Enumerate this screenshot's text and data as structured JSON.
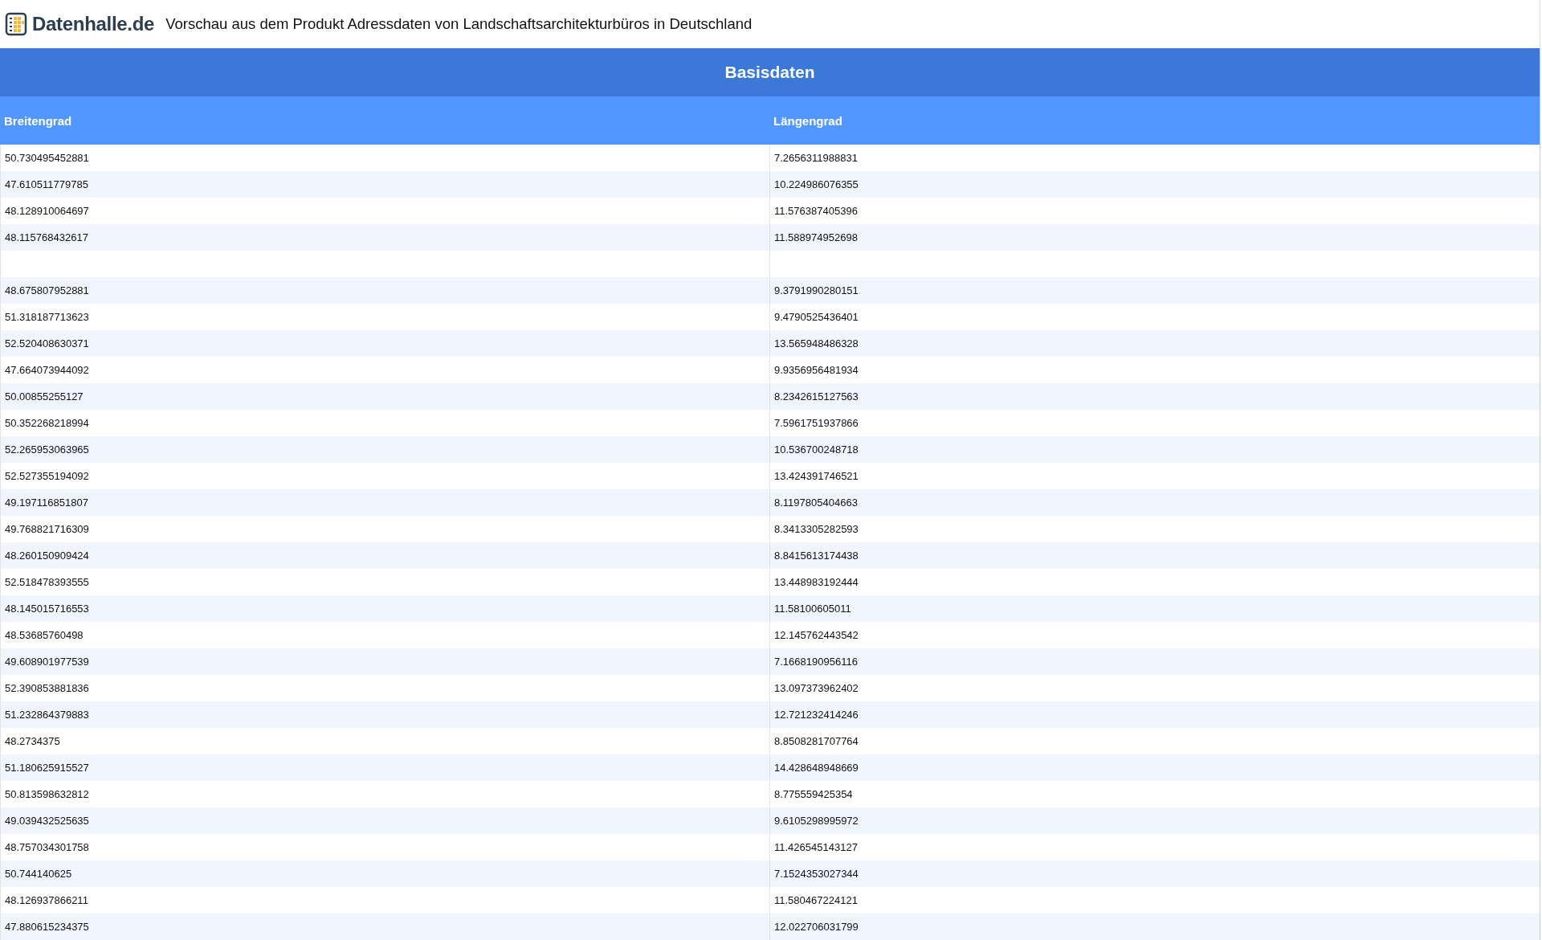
{
  "header": {
    "logo_text": "Datenhalle.de",
    "title": "Vorschau aus dem Produkt Adressdaten von Landschaftsarchitekturbüros in Deutschland"
  },
  "table": {
    "section_title": "Basisdaten",
    "columns": [
      "Breitengrad",
      "Längengrad"
    ],
    "rows": [
      {
        "cells": [
          "50.730495452881",
          "7.2656311988831"
        ]
      },
      {
        "cells": [
          "47.610511779785",
          "10.224986076355"
        ]
      },
      {
        "cells": [
          "48.128910064697",
          "11.576387405396"
        ]
      },
      {
        "cells": [
          "48.115768432617",
          "11.588974952698"
        ]
      },
      {},
      {
        "cells": [
          "48.675807952881",
          "9.3791990280151"
        ]
      },
      {
        "cells": [
          "51.318187713623",
          "9.4790525436401"
        ]
      },
      {
        "cells": [
          "52.520408630371",
          "13.565948486328"
        ]
      },
      {
        "cells": [
          "47.664073944092",
          "9.9356956481934"
        ]
      },
      {
        "cells": [
          "50.00855255127",
          "8.2342615127563"
        ]
      },
      {
        "cells": [
          "50.352268218994",
          "7.5961751937866"
        ]
      },
      {
        "cells": [
          "52.265953063965",
          "10.536700248718"
        ]
      },
      {
        "cells": [
          "52.527355194092",
          "13.424391746521"
        ]
      },
      {
        "cells": [
          "49.197116851807",
          "8.1197805404663"
        ]
      },
      {
        "cells": [
          "49.768821716309",
          "8.3413305282593"
        ]
      },
      {
        "cells": [
          "48.260150909424",
          "8.8415613174438"
        ]
      },
      {
        "cells": [
          "52.518478393555",
          "13.448983192444"
        ]
      },
      {
        "cells": [
          "48.145015716553",
          "11.58100605011"
        ]
      },
      {
        "cells": [
          "48.53685760498",
          "12.145762443542"
        ]
      },
      {
        "cells": [
          "49.608901977539",
          "7.1668190956116"
        ]
      },
      {
        "cells": [
          "52.390853881836",
          "13.097373962402"
        ]
      },
      {
        "cells": [
          "51.232864379883",
          "12.721232414246"
        ]
      },
      {
        "cells": [
          "48.2734375",
          "8.8508281707764"
        ]
      },
      {
        "cells": [
          "51.180625915527",
          "14.428648948669"
        ]
      },
      {
        "cells": [
          "50.813598632812",
          "8.775559425354"
        ]
      },
      {
        "cells": [
          "49.039432525635",
          "9.6105298995972"
        ]
      },
      {
        "cells": [
          "48.757034301758",
          "11.426545143127"
        ]
      },
      {
        "cells": [
          "50.744140625",
          "7.1524353027344"
        ]
      },
      {
        "cells": [
          "48.126937866211",
          "11.580467224121"
        ]
      },
      {
        "cells": [
          "47.880615234375",
          "12.022706031799"
        ]
      }
    ]
  }
}
